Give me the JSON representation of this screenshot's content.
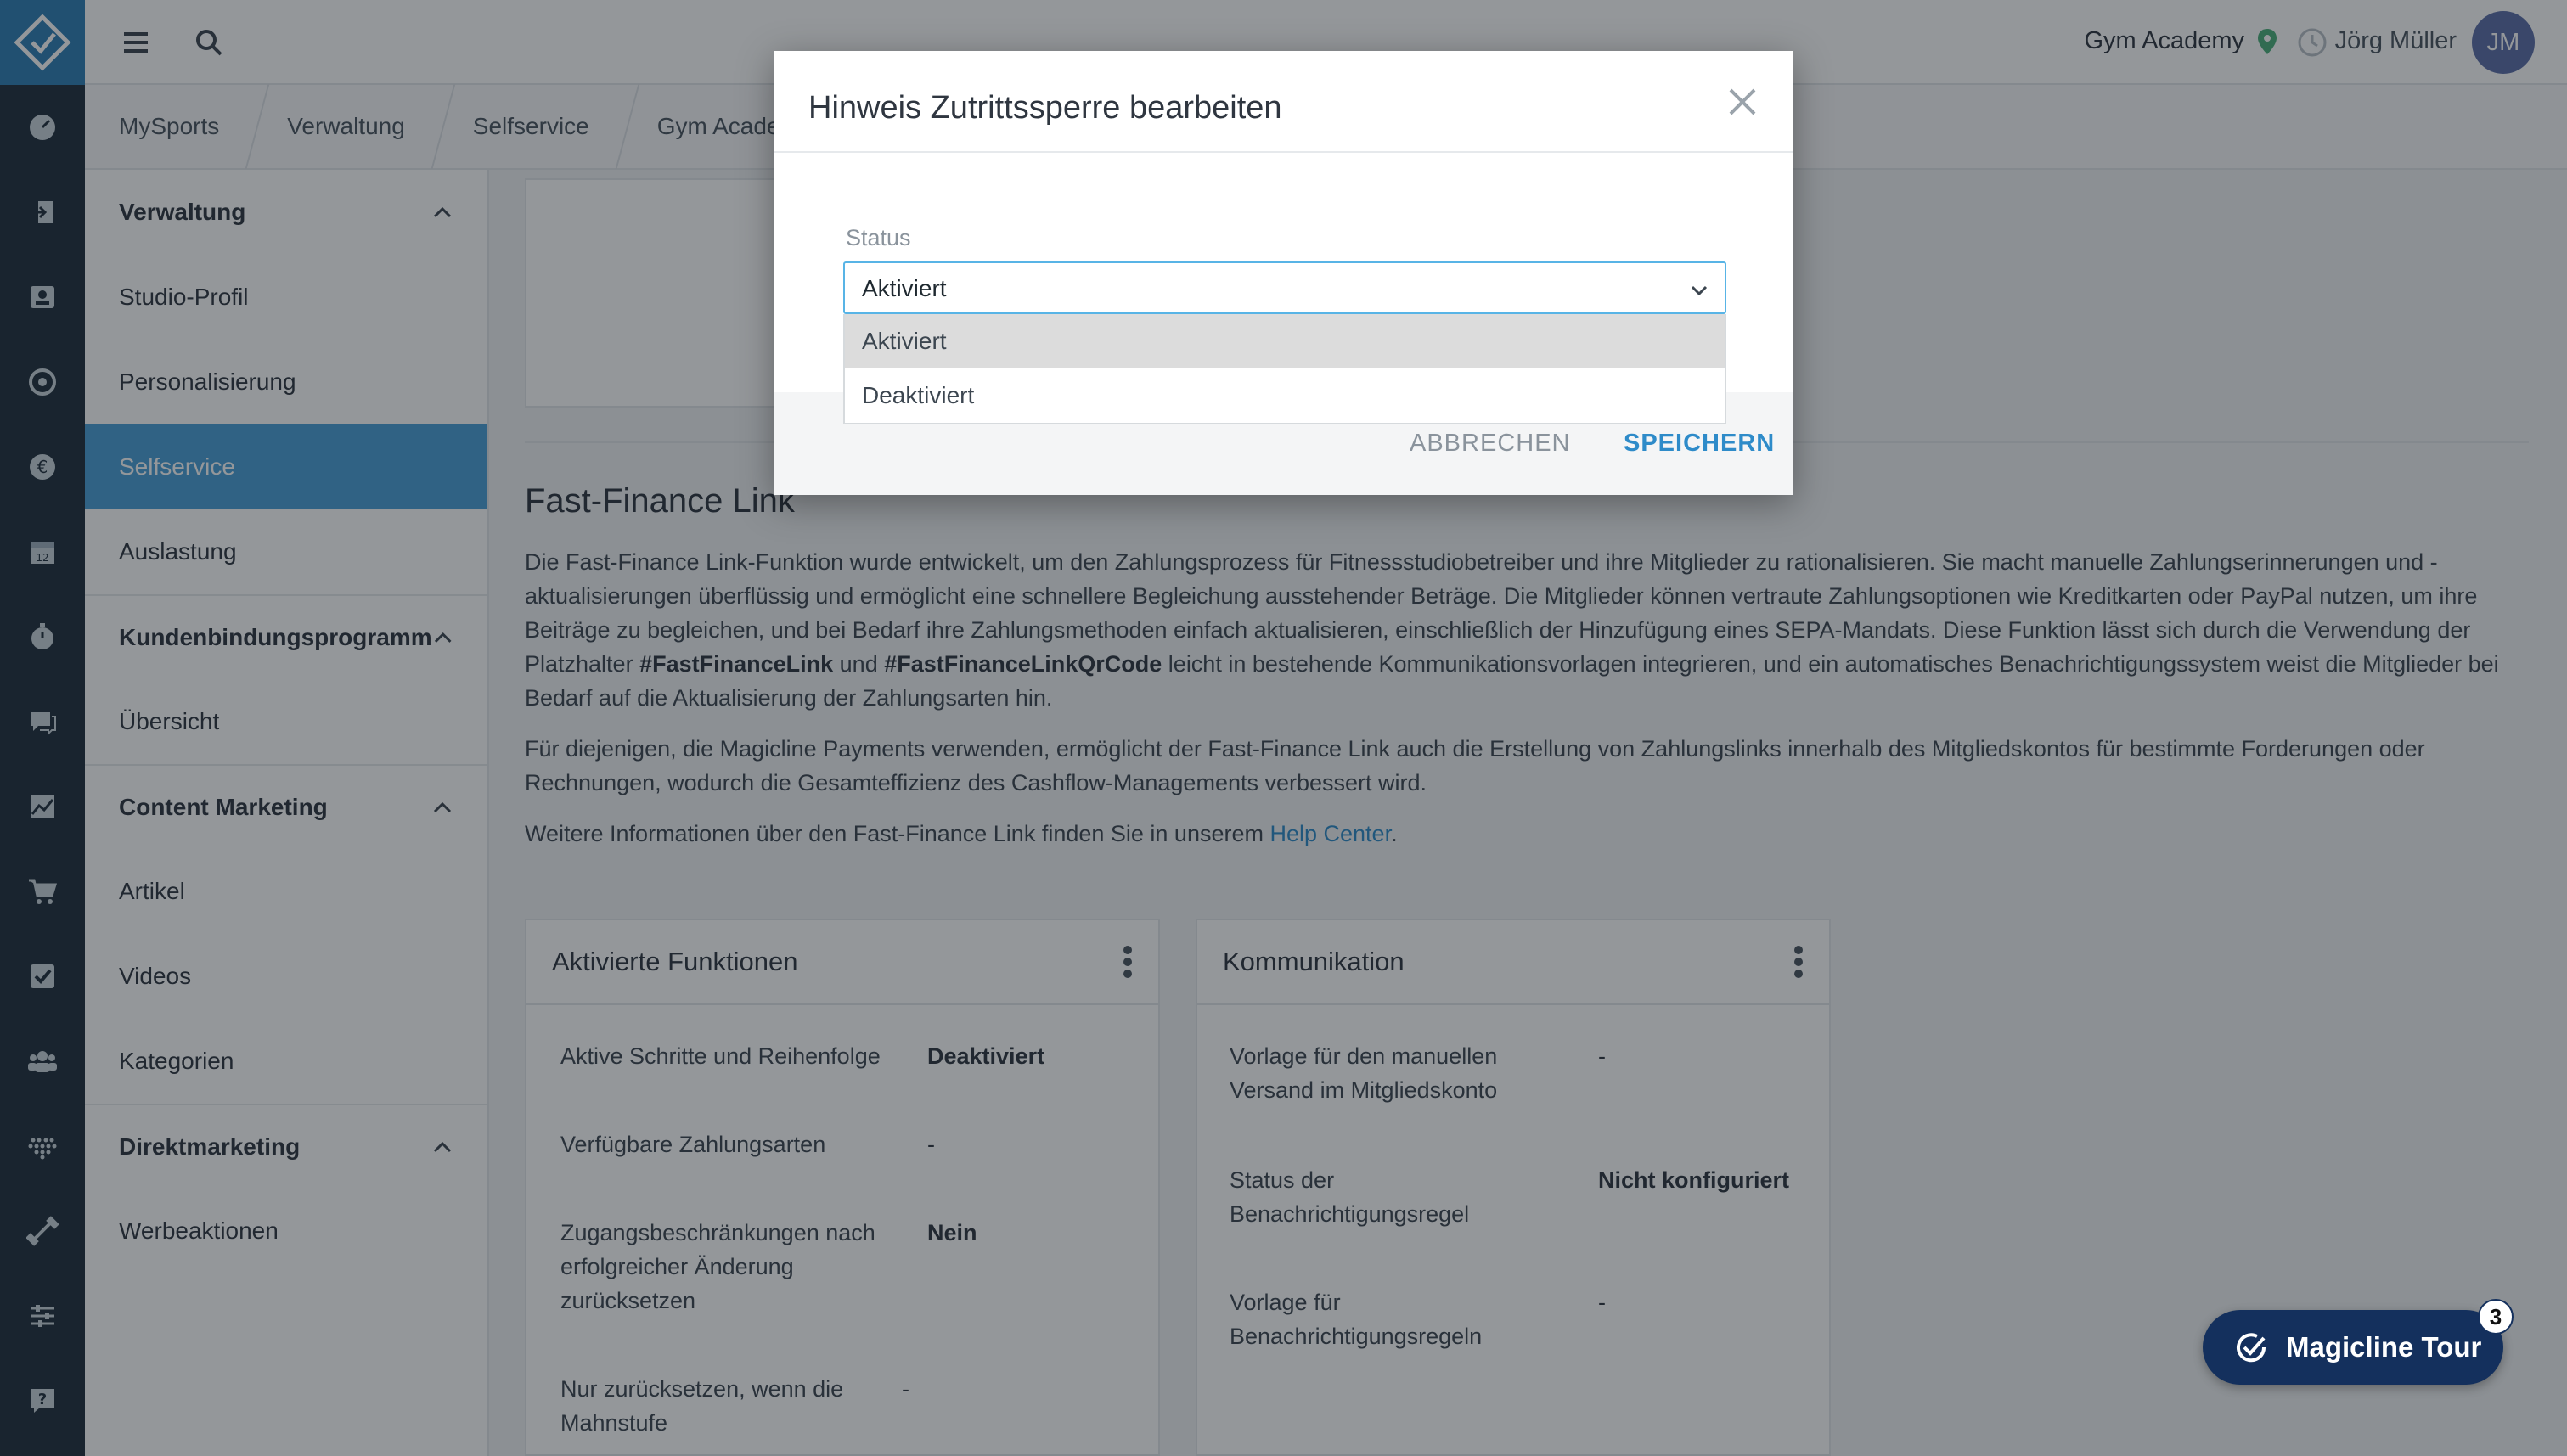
{
  "topbar": {
    "studio_name": "Gym Academy",
    "user_name": "Jörg Müller",
    "user_initials": "JM"
  },
  "breadcrumb": [
    "MySports",
    "Verwaltung",
    "Selfservice",
    "Gym Academy"
  ],
  "sidebar": {
    "groups": [
      {
        "label": "Verwaltung",
        "items": [
          "Studio-Profil",
          "Personalisierung",
          "Selfservice",
          "Auslastung"
        ]
      },
      {
        "label": "Kundenbindungsprogramm",
        "items": [
          "Übersicht"
        ]
      },
      {
        "label": "Content Marketing",
        "items": [
          "Artikel",
          "Videos",
          "Kategorien"
        ]
      },
      {
        "label": "Direktmarketing",
        "items": [
          "Werbeaktionen"
        ]
      }
    ],
    "active_item": "Selfservice"
  },
  "main": {
    "section_title": "Fast-Finance Link",
    "para1_a": "Die Fast-Finance Link-Funktion wurde entwickelt, um den Zahlungsprozess für Fitnessstudiobetreiber und ihre Mitglieder zu rationalisieren. Sie macht manuelle Zahlungserinnerungen und -aktualisierungen überflüssig und ermöglicht eine schnellere Begleichung ausstehender Beträge. Die Mitglieder können vertraute Zahlungsoptionen wie Kreditkarten oder PayPal nutzen, um ihre Beiträge zu begleichen, und bei Bedarf ihre Zahlungsmethoden einfach aktualisieren, einschließlich der Hinzufügung eines SEPA-Mandats. Diese Funktion lässt sich durch die Verwendung der Platzhalter ",
    "para1_ph1": "#FastFinanceLink",
    "para1_and": " und ",
    "para1_ph2": "#FastFinanceLinkQrCode",
    "para1_b": " leicht in bestehende Kommunikationsvorlagen integrieren, und ein automatisches Benachrichtigungssystem weist die Mitglieder bei Bedarf auf die Aktualisierung der Zahlungsarten hin.",
    "para2": "Für diejenigen, die Magicline Payments verwenden, ermöglicht der Fast-Finance Link auch die Erstellung von Zahlungslinks innerhalb des Mitgliedskontos für bestimmte Forderungen oder Rechnungen, wodurch die Gesamteffizienz des Cashflow-Managements verbessert wird.",
    "para3_text": "Weitere Informationen über den Fast-Finance Link finden Sie in unserem ",
    "para3_link": "Help Center",
    "para3_end": "."
  },
  "card_functions": {
    "title": "Aktivierte Funktionen",
    "rows": [
      {
        "label": "Aktive Schritte und Reihenfolge",
        "value": "Deaktiviert"
      },
      {
        "label": "Verfügbare Zahlungsarten",
        "value": "-"
      },
      {
        "label": "Zugangsbeschränkungen nach erfolgreicher Änderung zurücksetzen",
        "value": "Nein"
      },
      {
        "label": "Nur zurücksetzen, wenn die Mahnstufe",
        "value": "-"
      }
    ]
  },
  "card_communication": {
    "title": "Kommunikation",
    "rows": [
      {
        "label": "Vorlage für den manuellen Versand im Mitgliedskonto",
        "value": "-"
      },
      {
        "label": "Status der Benachrichtigungsregel",
        "value": "Nicht konfiguriert"
      },
      {
        "label": "Vorlage für Benachrichtigungsregeln",
        "value": "-"
      }
    ]
  },
  "modal": {
    "title": "Hinweis Zutrittssperre bearbeiten",
    "status_label": "Status",
    "status_value": "Aktiviert",
    "options": [
      "Aktiviert",
      "Deaktiviert"
    ],
    "cancel_label": "ABBRECHEN",
    "save_label": "SPEICHERN"
  },
  "tour": {
    "label": "Magicline Tour",
    "badge": "3"
  },
  "colors": {
    "accent": "#4a9fd8",
    "rail": "#1f2f3c",
    "tour": "#14305d",
    "link": "#2e8bc9"
  }
}
